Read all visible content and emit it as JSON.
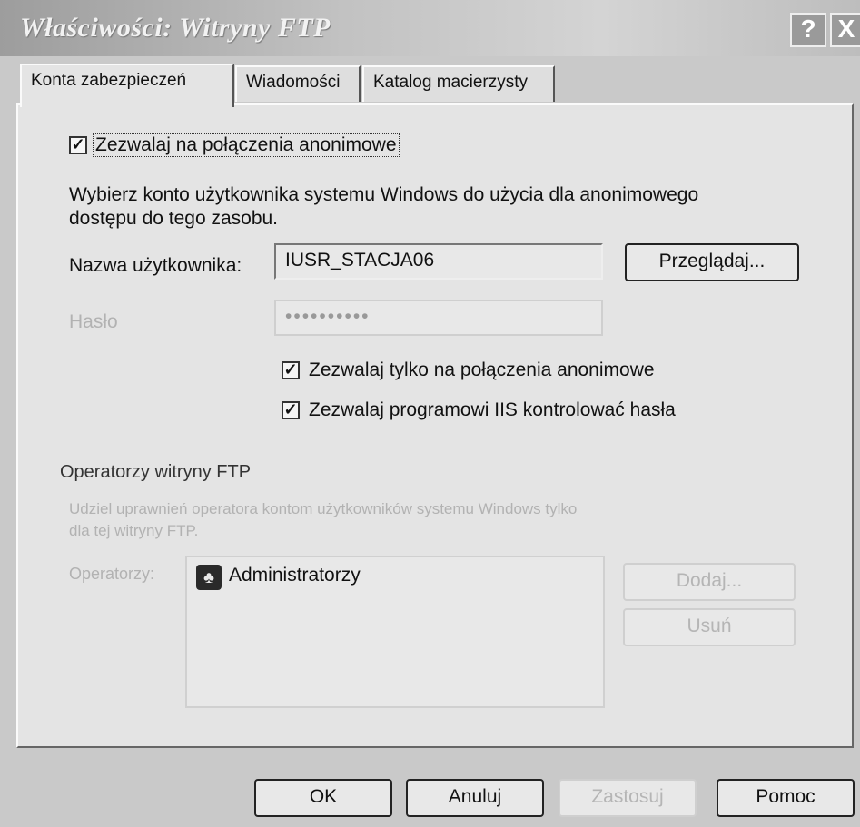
{
  "window": {
    "title": "Właściwości: Witryny FTP",
    "help_glyph": "?",
    "close_glyph": "X"
  },
  "tabs": [
    {
      "label": "Konta zabezpieczeń",
      "active": true
    },
    {
      "label": "Wiadomości",
      "active": false
    },
    {
      "label": "Katalog macierzysty",
      "active": false
    }
  ],
  "anonymous": {
    "allow_anonymous_label": "Zezwalaj na połączenia anonimowe",
    "allow_anonymous_checked": true,
    "description_line1": "Wybierz konto użytkownika systemu Windows do użycia dla anonimowego",
    "description_line2": "dostępu do tego zasobu.",
    "username_label": "Nazwa użytkownika:",
    "username_value": "IUSR_STACJA06",
    "browse_button": "Przeglądaj...",
    "password_label": "Hasło",
    "password_value": "••••••••••",
    "only_anonymous_label": "Zezwalaj tylko na połączenia anonimowe",
    "only_anonymous_checked": true,
    "iis_password_label": "Zezwalaj programowi IIS kontrolować hasła",
    "iis_password_checked": true
  },
  "operators": {
    "section_title": "Operatorzy witryny FTP",
    "description_line1": "Udziel uprawnień operatora kontom użytkowników systemu Windows tylko",
    "description_line2": "dla tej witryny FTP.",
    "list_label": "Operatorzy:",
    "items": [
      "Administratorzy"
    ],
    "add_button": "Dodaj...",
    "remove_button": "Usuń"
  },
  "footer": {
    "ok": "OK",
    "cancel": "Anuluj",
    "apply": "Zastosuj",
    "help": "Pomoc"
  },
  "colors": {
    "dialog_bg": "#e4e4e4",
    "disabled_text": "#b2b2b2"
  }
}
